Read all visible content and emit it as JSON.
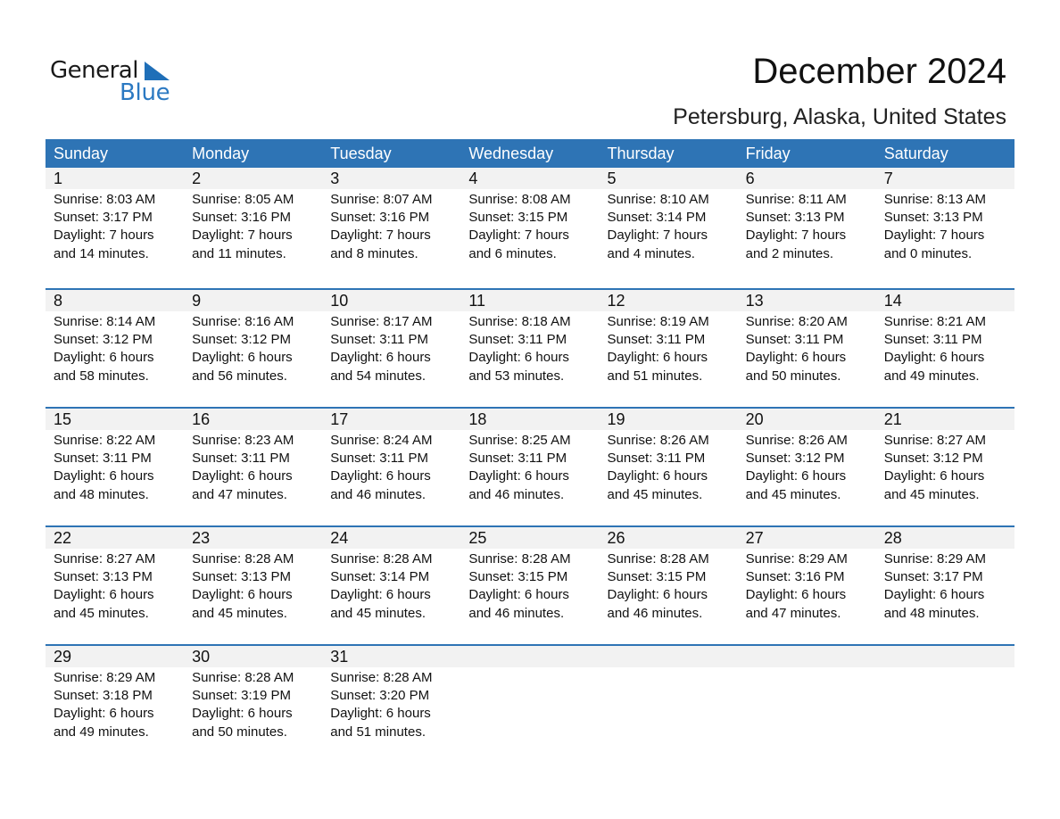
{
  "brand": {
    "line1": "General",
    "line2": "Blue",
    "accent": "#2e74b5"
  },
  "header": {
    "title": "December 2024",
    "location": "Petersburg, Alaska, United States"
  },
  "weekdays": [
    "Sunday",
    "Monday",
    "Tuesday",
    "Wednesday",
    "Thursday",
    "Friday",
    "Saturday"
  ],
  "weeks": [
    [
      {
        "day": "1",
        "sunrise": "Sunrise: 8:03 AM",
        "sunset": "Sunset: 3:17 PM",
        "daylight": "Daylight: 7 hours",
        "minutes": "and 14 minutes."
      },
      {
        "day": "2",
        "sunrise": "Sunrise: 8:05 AM",
        "sunset": "Sunset: 3:16 PM",
        "daylight": "Daylight: 7 hours",
        "minutes": "and 11 minutes."
      },
      {
        "day": "3",
        "sunrise": "Sunrise: 8:07 AM",
        "sunset": "Sunset: 3:16 PM",
        "daylight": "Daylight: 7 hours",
        "minutes": "and 8 minutes."
      },
      {
        "day": "4",
        "sunrise": "Sunrise: 8:08 AM",
        "sunset": "Sunset: 3:15 PM",
        "daylight": "Daylight: 7 hours",
        "minutes": "and 6 minutes."
      },
      {
        "day": "5",
        "sunrise": "Sunrise: 8:10 AM",
        "sunset": "Sunset: 3:14 PM",
        "daylight": "Daylight: 7 hours",
        "minutes": "and 4 minutes."
      },
      {
        "day": "6",
        "sunrise": "Sunrise: 8:11 AM",
        "sunset": "Sunset: 3:13 PM",
        "daylight": "Daylight: 7 hours",
        "minutes": "and 2 minutes."
      },
      {
        "day": "7",
        "sunrise": "Sunrise: 8:13 AM",
        "sunset": "Sunset: 3:13 PM",
        "daylight": "Daylight: 7 hours",
        "minutes": "and 0 minutes."
      }
    ],
    [
      {
        "day": "8",
        "sunrise": "Sunrise: 8:14 AM",
        "sunset": "Sunset: 3:12 PM",
        "daylight": "Daylight: 6 hours",
        "minutes": "and 58 minutes."
      },
      {
        "day": "9",
        "sunrise": "Sunrise: 8:16 AM",
        "sunset": "Sunset: 3:12 PM",
        "daylight": "Daylight: 6 hours",
        "minutes": "and 56 minutes."
      },
      {
        "day": "10",
        "sunrise": "Sunrise: 8:17 AM",
        "sunset": "Sunset: 3:11 PM",
        "daylight": "Daylight: 6 hours",
        "minutes": "and 54 minutes."
      },
      {
        "day": "11",
        "sunrise": "Sunrise: 8:18 AM",
        "sunset": "Sunset: 3:11 PM",
        "daylight": "Daylight: 6 hours",
        "minutes": "and 53 minutes."
      },
      {
        "day": "12",
        "sunrise": "Sunrise: 8:19 AM",
        "sunset": "Sunset: 3:11 PM",
        "daylight": "Daylight: 6 hours",
        "minutes": "and 51 minutes."
      },
      {
        "day": "13",
        "sunrise": "Sunrise: 8:20 AM",
        "sunset": "Sunset: 3:11 PM",
        "daylight": "Daylight: 6 hours",
        "minutes": "and 50 minutes."
      },
      {
        "day": "14",
        "sunrise": "Sunrise: 8:21 AM",
        "sunset": "Sunset: 3:11 PM",
        "daylight": "Daylight: 6 hours",
        "minutes": "and 49 minutes."
      }
    ],
    [
      {
        "day": "15",
        "sunrise": "Sunrise: 8:22 AM",
        "sunset": "Sunset: 3:11 PM",
        "daylight": "Daylight: 6 hours",
        "minutes": "and 48 minutes."
      },
      {
        "day": "16",
        "sunrise": "Sunrise: 8:23 AM",
        "sunset": "Sunset: 3:11 PM",
        "daylight": "Daylight: 6 hours",
        "minutes": "and 47 minutes."
      },
      {
        "day": "17",
        "sunrise": "Sunrise: 8:24 AM",
        "sunset": "Sunset: 3:11 PM",
        "daylight": "Daylight: 6 hours",
        "minutes": "and 46 minutes."
      },
      {
        "day": "18",
        "sunrise": "Sunrise: 8:25 AM",
        "sunset": "Sunset: 3:11 PM",
        "daylight": "Daylight: 6 hours",
        "minutes": "and 46 minutes."
      },
      {
        "day": "19",
        "sunrise": "Sunrise: 8:26 AM",
        "sunset": "Sunset: 3:11 PM",
        "daylight": "Daylight: 6 hours",
        "minutes": "and 45 minutes."
      },
      {
        "day": "20",
        "sunrise": "Sunrise: 8:26 AM",
        "sunset": "Sunset: 3:12 PM",
        "daylight": "Daylight: 6 hours",
        "minutes": "and 45 minutes."
      },
      {
        "day": "21",
        "sunrise": "Sunrise: 8:27 AM",
        "sunset": "Sunset: 3:12 PM",
        "daylight": "Daylight: 6 hours",
        "minutes": "and 45 minutes."
      }
    ],
    [
      {
        "day": "22",
        "sunrise": "Sunrise: 8:27 AM",
        "sunset": "Sunset: 3:13 PM",
        "daylight": "Daylight: 6 hours",
        "minutes": "and 45 minutes."
      },
      {
        "day": "23",
        "sunrise": "Sunrise: 8:28 AM",
        "sunset": "Sunset: 3:13 PM",
        "daylight": "Daylight: 6 hours",
        "minutes": "and 45 minutes."
      },
      {
        "day": "24",
        "sunrise": "Sunrise: 8:28 AM",
        "sunset": "Sunset: 3:14 PM",
        "daylight": "Daylight: 6 hours",
        "minutes": "and 45 minutes."
      },
      {
        "day": "25",
        "sunrise": "Sunrise: 8:28 AM",
        "sunset": "Sunset: 3:15 PM",
        "daylight": "Daylight: 6 hours",
        "minutes": "and 46 minutes."
      },
      {
        "day": "26",
        "sunrise": "Sunrise: 8:28 AM",
        "sunset": "Sunset: 3:15 PM",
        "daylight": "Daylight: 6 hours",
        "minutes": "and 46 minutes."
      },
      {
        "day": "27",
        "sunrise": "Sunrise: 8:29 AM",
        "sunset": "Sunset: 3:16 PM",
        "daylight": "Daylight: 6 hours",
        "minutes": "and 47 minutes."
      },
      {
        "day": "28",
        "sunrise": "Sunrise: 8:29 AM",
        "sunset": "Sunset: 3:17 PM",
        "daylight": "Daylight: 6 hours",
        "minutes": "and 48 minutes."
      }
    ],
    [
      {
        "day": "29",
        "sunrise": "Sunrise: 8:29 AM",
        "sunset": "Sunset: 3:18 PM",
        "daylight": "Daylight: 6 hours",
        "minutes": "and 49 minutes."
      },
      {
        "day": "30",
        "sunrise": "Sunrise: 8:28 AM",
        "sunset": "Sunset: 3:19 PM",
        "daylight": "Daylight: 6 hours",
        "minutes": "and 50 minutes."
      },
      {
        "day": "31",
        "sunrise": "Sunrise: 8:28 AM",
        "sunset": "Sunset: 3:20 PM",
        "daylight": "Daylight: 6 hours",
        "minutes": "and 51 minutes."
      },
      {
        "day": "",
        "sunrise": "",
        "sunset": "",
        "daylight": "",
        "minutes": ""
      },
      {
        "day": "",
        "sunrise": "",
        "sunset": "",
        "daylight": "",
        "minutes": ""
      },
      {
        "day": "",
        "sunrise": "",
        "sunset": "",
        "daylight": "",
        "minutes": ""
      },
      {
        "day": "",
        "sunrise": "",
        "sunset": "",
        "daylight": "",
        "minutes": ""
      }
    ]
  ]
}
